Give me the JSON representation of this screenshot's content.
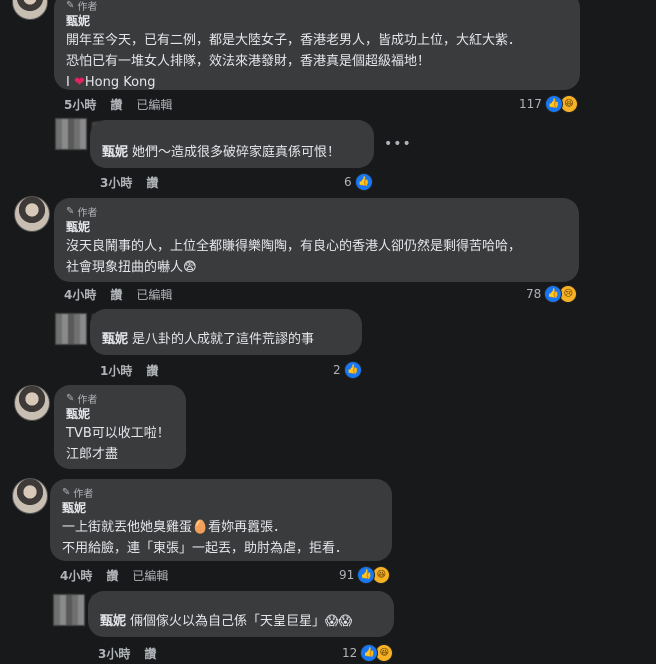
{
  "author_tag": "作者",
  "comments": [
    {
      "name": "甄妮",
      "lines": [
        "開年至今天，已有二例，都是大陸女子，香港老男人，皆成功上位，大紅大紫．",
        "恐怕已有一堆女人排隊，效法來港發財，香港真是個超級福地！"
      ],
      "extra_prefix": "I ",
      "extra_suffix": "Hong Kong",
      "time": "5小時",
      "reply": "讚",
      "edited": "已編輯",
      "count": "117",
      "reaction2": "laugh"
    },
    {
      "name": "甄妮",
      "text": "她們～造成很多破碎家庭真係可恨！",
      "time": "3小時",
      "reply": "讚",
      "count": "6"
    },
    {
      "name": "甄妮",
      "lines": [
        "沒天良鬧事的人，上位全都賺得樂陶陶，有良心的香港人卻仍然是剩得苦哈哈，",
        "社會現象扭曲的嚇人😨"
      ],
      "time": "4小時",
      "reply": "讚",
      "edited": "已編輯",
      "count": "78",
      "reaction2": "sad"
    },
    {
      "name": "甄妮",
      "text": "是八卦的人成就了這件荒謬的事",
      "time": "1小時",
      "reply": "讚",
      "count": "2"
    },
    {
      "name": "甄妮",
      "lines": [
        "TVB可以收工啦！",
        "江郎才盡"
      ]
    },
    {
      "name": "甄妮",
      "lines": [
        "一上街就丟他她臭雞蛋🥚看妳再囂張．",
        "不用給臉，連「東張」一起丟，助肘為虐，拒看．"
      ],
      "time": "4小時",
      "reply": "讚",
      "edited": "已編輯",
      "count": "91",
      "reaction2": "laugh"
    },
    {
      "name": "甄妮",
      "text": "倆個傢火以為自己係「天皇巨星」😱😱",
      "time": "3小時",
      "reply": "讚",
      "count": "12",
      "reaction2": "laugh"
    }
  ]
}
